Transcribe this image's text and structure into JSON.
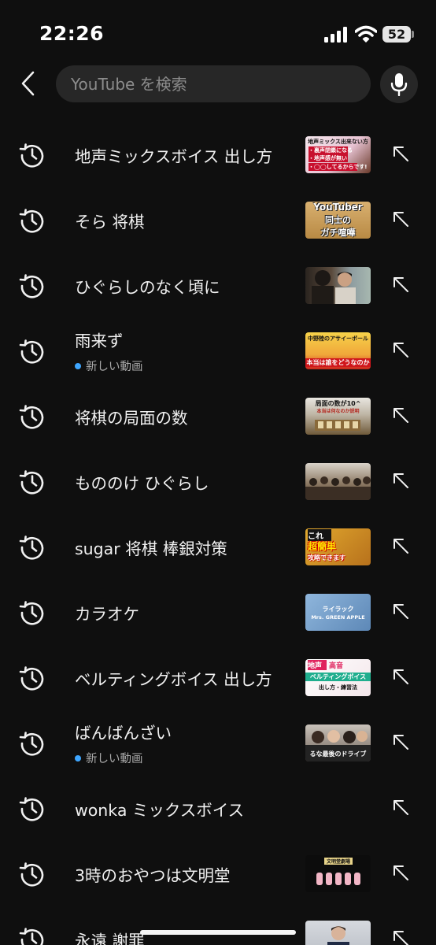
{
  "status_bar": {
    "time": "22:26",
    "battery": "52"
  },
  "search": {
    "placeholder": "YouTube を検索",
    "value": ""
  },
  "suggestions": [
    {
      "label": "地声ミックスボイス 出し方",
      "thumb_text": [
        "地声ミックス出来ない方",
        "・裏声閉鎖になる",
        "・地声感が無い",
        "・◯◯してるからです!"
      ]
    },
    {
      "label": "そら 将棋",
      "thumb_text": [
        "YouTuber",
        "同士の",
        "ガチ喧嘩"
      ]
    },
    {
      "label": "ひぐらしのなく頃に"
    },
    {
      "label": "雨来ず",
      "sub": "新しい動画",
      "thumb_text": [
        "中野陸のアサイーボール",
        "本当は誰をどうなのか"
      ]
    },
    {
      "label": "将棋の局面の数",
      "thumb_text": [
        "局面の数が10^",
        "本当は何なのか説明"
      ]
    },
    {
      "label": "もののけ ひぐらし"
    },
    {
      "label": "sugar 将棋 棒銀対策",
      "thumb_text": [
        "これ",
        "超簡単",
        "攻略できます"
      ]
    },
    {
      "label": "カラオケ",
      "thumb_text": [
        "ライラック",
        "Mrs. GREEN APPLE"
      ]
    },
    {
      "label": "ベルティングボイス 出し方",
      "thumb_text": [
        "地声",
        "高音",
        "ベルティングボイス",
        "出し方・練習法"
      ]
    },
    {
      "label": "ばんばんざい",
      "sub": "新しい動画",
      "thumb_text": [
        "るな最後のドライブ"
      ]
    },
    {
      "label": "wonka ミックスボイス"
    },
    {
      "label": "3時のおやつは文明堂",
      "thumb_text": [
        "文明堂劇場"
      ]
    },
    {
      "label": "永遠 謝罪"
    }
  ]
}
